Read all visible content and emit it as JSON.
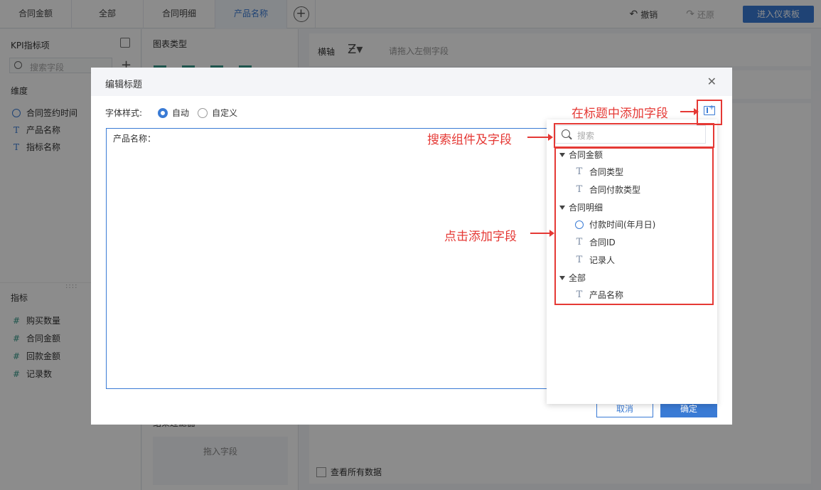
{
  "tabs": [
    {
      "label": "合同金额",
      "active": false
    },
    {
      "label": "全部",
      "active": false
    },
    {
      "label": "合同明细",
      "active": false
    },
    {
      "label": "产品名称",
      "active": true
    }
  ],
  "toolbar": {
    "undo_label": "撤销",
    "redo_label": "还原",
    "enter_dashboard_label": "进入仪表板"
  },
  "left_panel": {
    "kpi_title": "KPI指标项",
    "search_placeholder": "搜索字段",
    "dimension_title": "维度",
    "dimensions": [
      "合同签约时间",
      "产品名称",
      "指标名称"
    ],
    "measure_title": "指标",
    "measures": [
      "购买数量",
      "合同金额",
      "回款金额",
      "记录数"
    ]
  },
  "mid_panel": {
    "chart_type_title": "图表类型",
    "filter_title": "结果过滤器",
    "drop_field": "拖入字段"
  },
  "main": {
    "axis_label": "横轴",
    "axis_placeholder": "请拖入左侧字段",
    "show_all_label": "查看所有数据"
  },
  "dialog": {
    "title": "编辑标题",
    "font_style_label": "字体样式:",
    "radio_auto": "自动",
    "radio_custom": "自定义",
    "title_text": "产品名称：",
    "cancel_label": "取消",
    "ok_label": "确定"
  },
  "field_popup": {
    "search_placeholder": "搜索",
    "groups": [
      {
        "name": "合同金额",
        "fields": [
          {
            "label": "合同类型",
            "type": "text"
          },
          {
            "label": "合同付款类型",
            "type": "text"
          }
        ]
      },
      {
        "name": "合同明细",
        "fields": [
          {
            "label": "付款时间(年月日)",
            "type": "date"
          },
          {
            "label": "合同ID",
            "type": "text"
          },
          {
            "label": "记录人",
            "type": "text"
          }
        ]
      },
      {
        "name": "全部",
        "fields": [
          {
            "label": "产品名称",
            "type": "text"
          }
        ]
      }
    ]
  },
  "annotations": {
    "add_field": "在标题中添加字段",
    "search": "搜索组件及字段",
    "click_add": "点击添加字段"
  },
  "colors": {
    "accent": "#3a7bd5",
    "annotation": "#e53935"
  }
}
